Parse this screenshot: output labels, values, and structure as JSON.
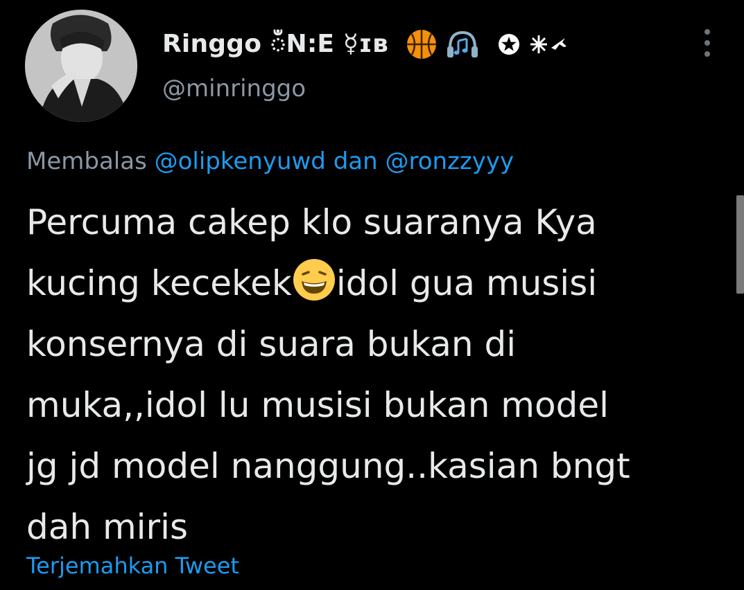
{
  "author": {
    "display_name": "Ringgo ඁN:E ☿ɪʙ",
    "handle": "@minringgo",
    "badge_icons": [
      "basketball-icon",
      "headphones-music-icon",
      "star-circle-icon",
      "sparkle-airplane-icon"
    ]
  },
  "reply_context": {
    "prefix": "Membalas",
    "mention_1": "@olipkenyuwd",
    "connector": "dan",
    "mention_2": "@ronzzyyy"
  },
  "tweet": {
    "line1": "Percuma cakep klo suaranya Kya",
    "line2a": "kucing kecekek",
    "line2b": "idol gua musisi",
    "line3": "konsernya di suara bukan di",
    "line4": "muka,,idol lu musisi bukan model",
    "line5": "jg jd model nanggung..kasian bngt",
    "line6": "dah miris",
    "emoji": "grinning-squint-emoji"
  },
  "translate_link": "Terjemahkan Tweet",
  "colors": {
    "background": "#000000",
    "text": "#e7e9ea",
    "muted": "#8b98a5",
    "link": "#1d9bf0"
  }
}
